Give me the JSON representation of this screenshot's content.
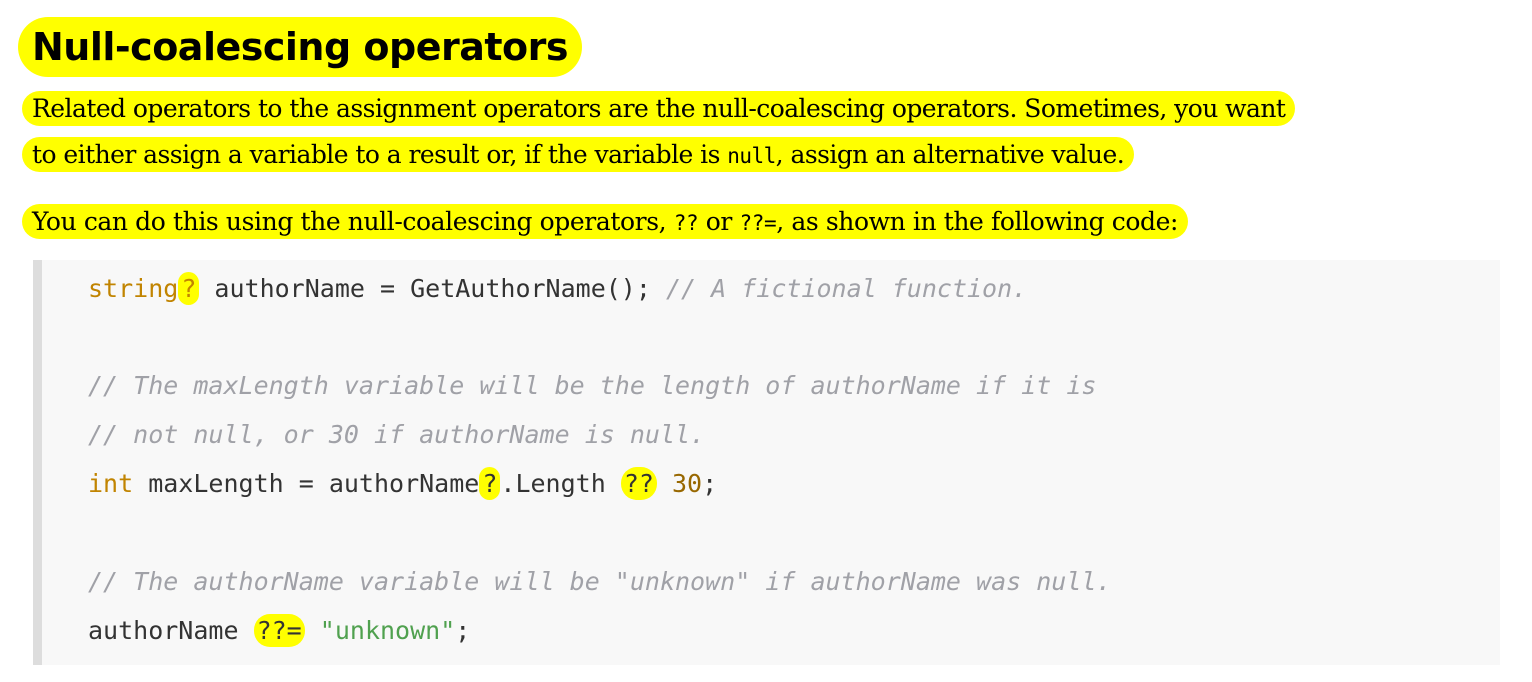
{
  "heading": "Null-coalescing operators",
  "paragraph1": {
    "line1": "Related operators to the assignment operators are the null-coalescing operators. Sometimes, you want",
    "line2_before": "to either assign a variable to a result or, if the variable is ",
    "line2_code": "null",
    "line2_after": ", assign an alternative value."
  },
  "paragraph2": {
    "before": "You can do this using the null-coalescing operators, ",
    "code1": "??",
    "middle": " or ",
    "code2": "??=",
    "after": ", as shown in the following code:"
  },
  "code": {
    "line1": {
      "type_kw": "string",
      "nullable": "?",
      "rest": " authorName = GetAuthorName(); ",
      "comment": "// A fictional function."
    },
    "line2_comment": "// The maxLength variable will be the length of authorName if it is",
    "line3_comment": "// not null, or 30 if authorName is null.",
    "line4": {
      "type_kw": "int",
      "part1": " maxLength = authorName",
      "null_conditional": "?",
      "part2": ".Length ",
      "coalesce": "??",
      "number": "30",
      "end": ";"
    },
    "line5_comment": "// The authorName variable will be \"unknown\" if authorName was null.",
    "line6": {
      "part1": "authorName ",
      "coalesce_assign": "??=",
      "string": "\"unknown\"",
      "end": ";"
    }
  },
  "colors": {
    "highlight": "#ffff00",
    "keyword": "#c18401",
    "comment": "#a0a1a7",
    "number": "#986801",
    "string": "#50a14f",
    "code_background": "#f8f8f8",
    "code_border": "#dddddd"
  }
}
